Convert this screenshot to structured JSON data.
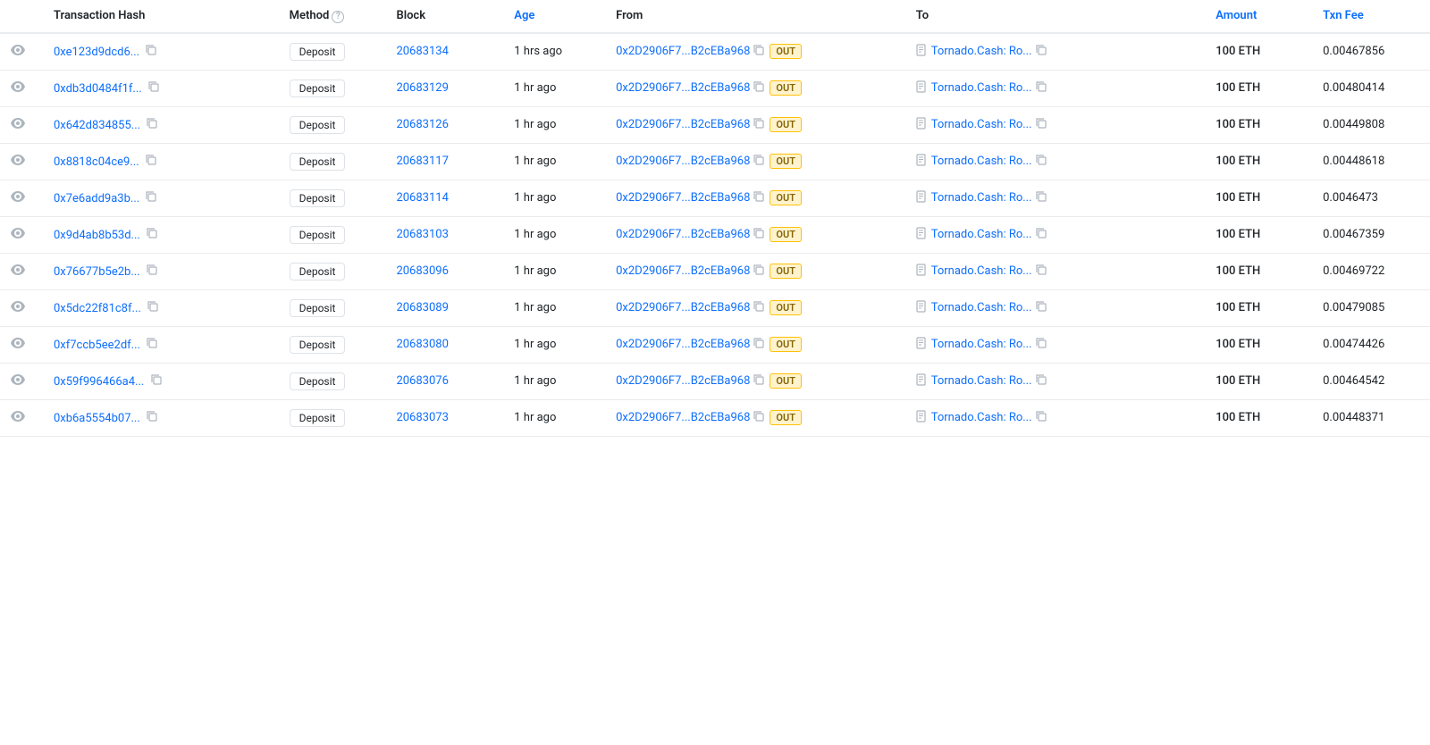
{
  "columns": {
    "eye": "",
    "transaction_hash": "Transaction Hash",
    "method": "Method",
    "block": "Block",
    "age": "Age",
    "from": "From",
    "to": "To",
    "amount": "Amount",
    "txn_fee": "Txn Fee"
  },
  "rows": [
    {
      "hash": "0xe123d9dcd6...",
      "block": "20683134",
      "age": "1 hrs ago",
      "from": "0x2D2906F7...B2cEBa968",
      "to": "Tornado.Cash: Ro...",
      "amount": "100 ETH",
      "txn_fee": "0.00467856"
    },
    {
      "hash": "0xdb3d0484f1f...",
      "block": "20683129",
      "age": "1 hr ago",
      "from": "0x2D2906F7...B2cEBa968",
      "to": "Tornado.Cash: Ro...",
      "amount": "100 ETH",
      "txn_fee": "0.00480414"
    },
    {
      "hash": "0x642d834855...",
      "block": "20683126",
      "age": "1 hr ago",
      "from": "0x2D2906F7...B2cEBa968",
      "to": "Tornado.Cash: Ro...",
      "amount": "100 ETH",
      "txn_fee": "0.00449808"
    },
    {
      "hash": "0x8818c04ce9...",
      "block": "20683117",
      "age": "1 hr ago",
      "from": "0x2D2906F7...B2cEBa968",
      "to": "Tornado.Cash: Ro...",
      "amount": "100 ETH",
      "txn_fee": "0.00448618"
    },
    {
      "hash": "0x7e6add9a3b...",
      "block": "20683114",
      "age": "1 hr ago",
      "from": "0x2D2906F7...B2cEBa968",
      "to": "Tornado.Cash: Ro...",
      "amount": "100 ETH",
      "txn_fee": "0.0046473"
    },
    {
      "hash": "0x9d4ab8b53d...",
      "block": "20683103",
      "age": "1 hr ago",
      "from": "0x2D2906F7...B2cEBa968",
      "to": "Tornado.Cash: Ro...",
      "amount": "100 ETH",
      "txn_fee": "0.00467359"
    },
    {
      "hash": "0x76677b5e2b...",
      "block": "20683096",
      "age": "1 hr ago",
      "from": "0x2D2906F7...B2cEBa968",
      "to": "Tornado.Cash: Ro...",
      "amount": "100 ETH",
      "txn_fee": "0.00469722"
    },
    {
      "hash": "0x5dc22f81c8f...",
      "block": "20683089",
      "age": "1 hr ago",
      "from": "0x2D2906F7...B2cEBa968",
      "to": "Tornado.Cash: Ro...",
      "amount": "100 ETH",
      "txn_fee": "0.00479085"
    },
    {
      "hash": "0xf7ccb5ee2df...",
      "block": "20683080",
      "age": "1 hr ago",
      "from": "0x2D2906F7...B2cEBa968",
      "to": "Tornado.Cash: Ro...",
      "amount": "100 ETH",
      "txn_fee": "0.00474426"
    },
    {
      "hash": "0x59f996466a4...",
      "block": "20683076",
      "age": "1 hr ago",
      "from": "0x2D2906F7...B2cEBa968",
      "to": "Tornado.Cash: Ro...",
      "amount": "100 ETH",
      "txn_fee": "0.00464542"
    },
    {
      "hash": "0xb6a5554b07...",
      "block": "20683073",
      "age": "1 hr ago",
      "from": "0x2D2906F7...B2cEBa968",
      "to": "Tornado.Cash: Ro...",
      "amount": "100 ETH",
      "txn_fee": "0.00448371"
    }
  ],
  "method_label": "Deposit",
  "out_badge": "OUT",
  "icons": {
    "eye": "👁",
    "copy": "⧉",
    "info": "?",
    "document": "📄"
  }
}
